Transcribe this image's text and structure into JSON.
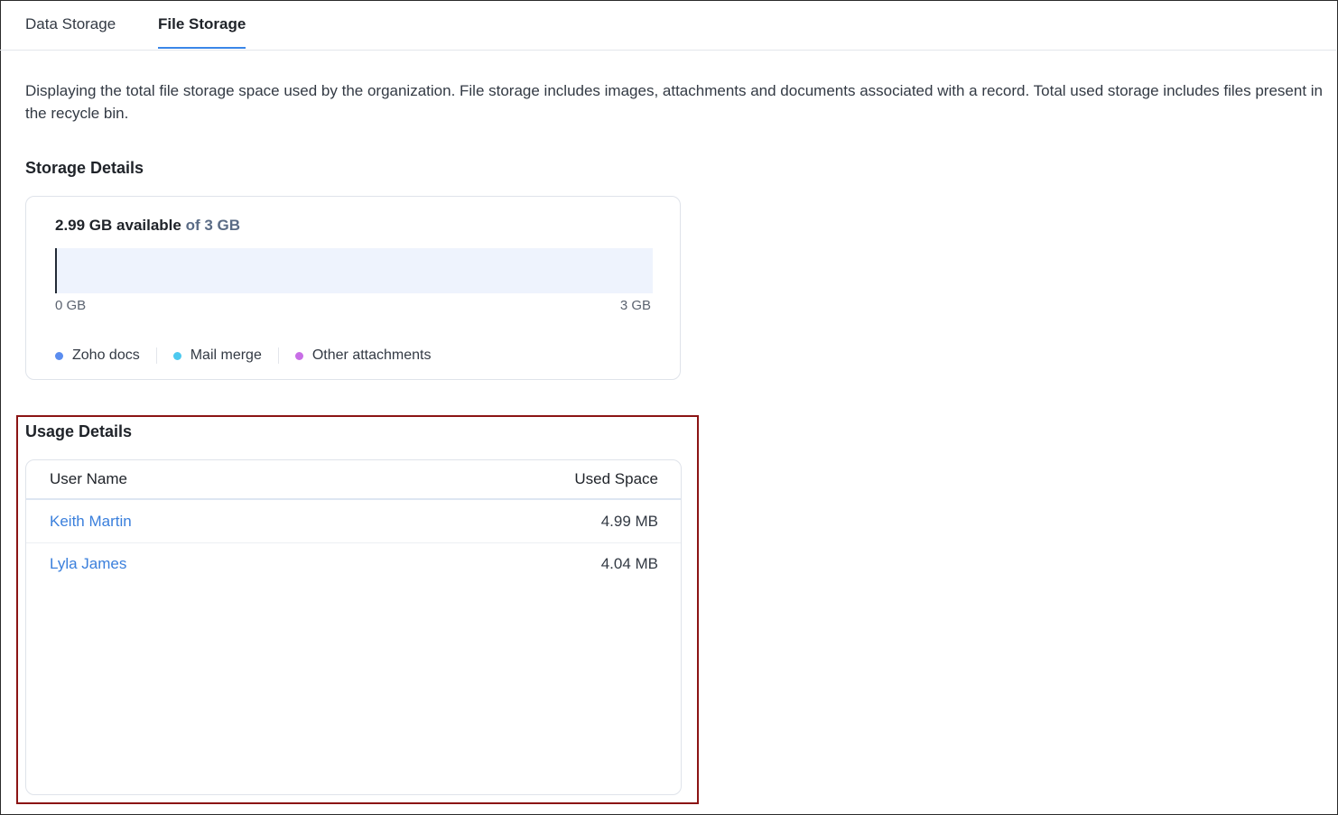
{
  "tabs": [
    {
      "label": "Data Storage",
      "active": false
    },
    {
      "label": "File Storage",
      "active": true
    }
  ],
  "description": "Displaying the total file storage space used by the organization. File storage includes images, attachments and documents associated with a record. Total used storage includes files present in the recycle bin.",
  "storage_details": {
    "title": "Storage Details",
    "available": "2.99 GB available",
    "of_total": " of 3 GB",
    "used_fraction": 0.002,
    "scale_min": "0 GB",
    "scale_max": "3 GB",
    "legend": [
      {
        "label": "Zoho docs",
        "color": "#5b8def"
      },
      {
        "label": "Mail merge",
        "color": "#4dc9ef"
      },
      {
        "label": "Other attachments",
        "color": "#c86ee6"
      }
    ]
  },
  "usage_details": {
    "title": "Usage Details",
    "columns": [
      "User Name",
      "Used Space"
    ],
    "rows": [
      {
        "user": "Keith Martin",
        "used": "4.99 MB"
      },
      {
        "user": "Lyla James",
        "used": "4.04 MB"
      }
    ]
  },
  "colors": {
    "accent": "#3a86e8",
    "link": "#3a7fdc",
    "highlight_border": "#8b1414"
  }
}
